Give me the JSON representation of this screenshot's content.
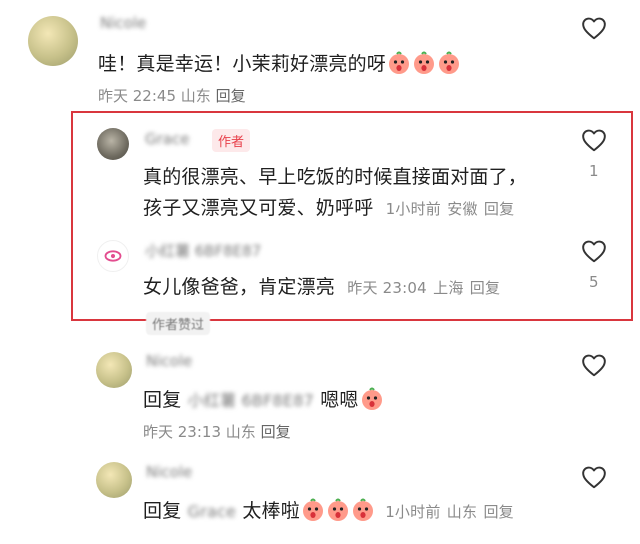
{
  "comments": [
    {
      "username": "Nicole",
      "text": "哇！真是幸运！小茉莉好漂亮的呀",
      "emoji_count": 3,
      "time": "昨天 22:45",
      "location": "山东",
      "reply_label": "回复"
    }
  ],
  "replies": [
    {
      "username": "Grace",
      "author_badge": "作者",
      "line1": "真的很漂亮、早上吃饭的时候直接面对面了，",
      "line2": "孩子又漂亮又可爱、奶呼呼",
      "time": "1小时前",
      "location": "安徽",
      "reply_label": "回复",
      "like_count": "1"
    },
    {
      "username": "小红薯 6BF8E87",
      "text": "女儿像爸爸，肯定漂亮",
      "time": "昨天 23:04",
      "location": "上海",
      "reply_label": "回复",
      "like_count": "5"
    }
  ],
  "author_liked_badge": "作者赞过",
  "thread2": [
    {
      "username": "Nicole",
      "prefix": "回复",
      "mention": "小红薯 6BF8E87",
      "text": "嗯嗯",
      "emoji_count": 1,
      "time": "昨天 23:13",
      "location": "山东",
      "reply_label": "回复"
    },
    {
      "username": "Nicole",
      "prefix": "回复",
      "mention": "Grace",
      "text": "太棒啦",
      "emoji_count": 3,
      "time": "1小时前",
      "location": "山东",
      "reply_label": "回复"
    }
  ],
  "colors": {
    "highlight_border": "#d9363e",
    "author_badge_bg": "#fde9ea",
    "author_badge_text": "#e8414b",
    "meta_text": "#8a8a8a"
  }
}
